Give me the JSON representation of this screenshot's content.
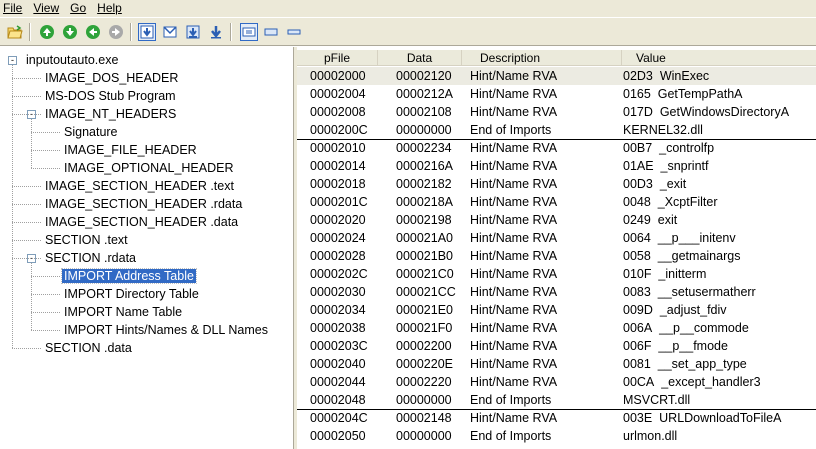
{
  "menu": [
    "File",
    "View",
    "Go",
    "Help"
  ],
  "toolbar": {
    "icons": [
      "open-folder-icon",
      "go-up-icon",
      "go-next-icon",
      "go-back-icon",
      "go-disabled-icon",
      "view-download-icon",
      "view-mail-icon",
      "view-save-icon",
      "view-down-arrow-icon",
      "view-grid-icon",
      "view-list-icon",
      "view-line-icon"
    ]
  },
  "tree": [
    {
      "label": "inputoutauto.exe",
      "level": 0,
      "expander": "-"
    },
    {
      "label": "IMAGE_DOS_HEADER",
      "level": 1
    },
    {
      "label": "MS-DOS Stub Program",
      "level": 1
    },
    {
      "label": "IMAGE_NT_HEADERS",
      "level": 1,
      "expander": "-"
    },
    {
      "label": "Signature",
      "level": 2
    },
    {
      "label": "IMAGE_FILE_HEADER",
      "level": 2
    },
    {
      "label": "IMAGE_OPTIONAL_HEADER",
      "level": 2
    },
    {
      "label": "IMAGE_SECTION_HEADER .text",
      "level": 1
    },
    {
      "label": "IMAGE_SECTION_HEADER .rdata",
      "level": 1
    },
    {
      "label": "IMAGE_SECTION_HEADER .data",
      "level": 1
    },
    {
      "label": "SECTION .text",
      "level": 1
    },
    {
      "label": "SECTION .rdata",
      "level": 1,
      "expander": "-"
    },
    {
      "label": "IMPORT Address Table",
      "level": 2,
      "selected": true
    },
    {
      "label": "IMPORT Directory Table",
      "level": 2
    },
    {
      "label": "IMPORT Name Table",
      "level": 2
    },
    {
      "label": "IMPORT Hints/Names & DLL Names",
      "level": 2
    },
    {
      "label": "SECTION .data",
      "level": 1
    }
  ],
  "table": {
    "headers": [
      "pFile",
      "Data",
      "Description",
      "Value"
    ],
    "rows": [
      [
        "00002000",
        "00002120",
        "Hint/Name RVA",
        "02D3  WinExec"
      ],
      [
        "00002004",
        "0000212A",
        "Hint/Name RVA",
        "0165  GetTempPathA"
      ],
      [
        "00002008",
        "00002108",
        "Hint/Name RVA",
        "017D  GetWindowsDirectoryA"
      ],
      [
        "0000200C",
        "00000000",
        "End of Imports",
        "KERNEL32.dll"
      ],
      [
        "00002010",
        "00002234",
        "Hint/Name RVA",
        "00B7  _controlfp"
      ],
      [
        "00002014",
        "0000216A",
        "Hint/Name RVA",
        "01AE  _snprintf"
      ],
      [
        "00002018",
        "00002182",
        "Hint/Name RVA",
        "00D3  _exit"
      ],
      [
        "0000201C",
        "0000218A",
        "Hint/Name RVA",
        "0048  _XcptFilter"
      ],
      [
        "00002020",
        "00002198",
        "Hint/Name RVA",
        "0249  exit"
      ],
      [
        "00002024",
        "000021A0",
        "Hint/Name RVA",
        "0064  __p___initenv"
      ],
      [
        "00002028",
        "000021B0",
        "Hint/Name RVA",
        "0058  __getmainargs"
      ],
      [
        "0000202C",
        "000021C0",
        "Hint/Name RVA",
        "010F  _initterm"
      ],
      [
        "00002030",
        "000021CC",
        "Hint/Name RVA",
        "0083  __setusermatherr"
      ],
      [
        "00002034",
        "000021E0",
        "Hint/Name RVA",
        "009D  _adjust_fdiv"
      ],
      [
        "00002038",
        "000021F0",
        "Hint/Name RVA",
        "006A  __p__commode"
      ],
      [
        "0000203C",
        "00002200",
        "Hint/Name RVA",
        "006F  __p__fmode"
      ],
      [
        "00002040",
        "0000220E",
        "Hint/Name RVA",
        "0081  __set_app_type"
      ],
      [
        "00002044",
        "00002220",
        "Hint/Name RVA",
        "00CA  _except_handler3"
      ],
      [
        "00002048",
        "00000000",
        "End of Imports",
        "MSVCRT.dll"
      ],
      [
        "0000204C",
        "00002148",
        "Hint/Name RVA",
        "003E  URLDownloadToFileA"
      ],
      [
        "00002050",
        "00000000",
        "End of Imports",
        "urlmon.dll"
      ]
    ],
    "highlighted_row": 0,
    "dividers_after": [
      3,
      18
    ]
  },
  "colors": {
    "chrome": "#ece9d8",
    "selection": "#316ac5",
    "header_bg": "#ebeadb",
    "highlight_row": "#ecebe2"
  }
}
